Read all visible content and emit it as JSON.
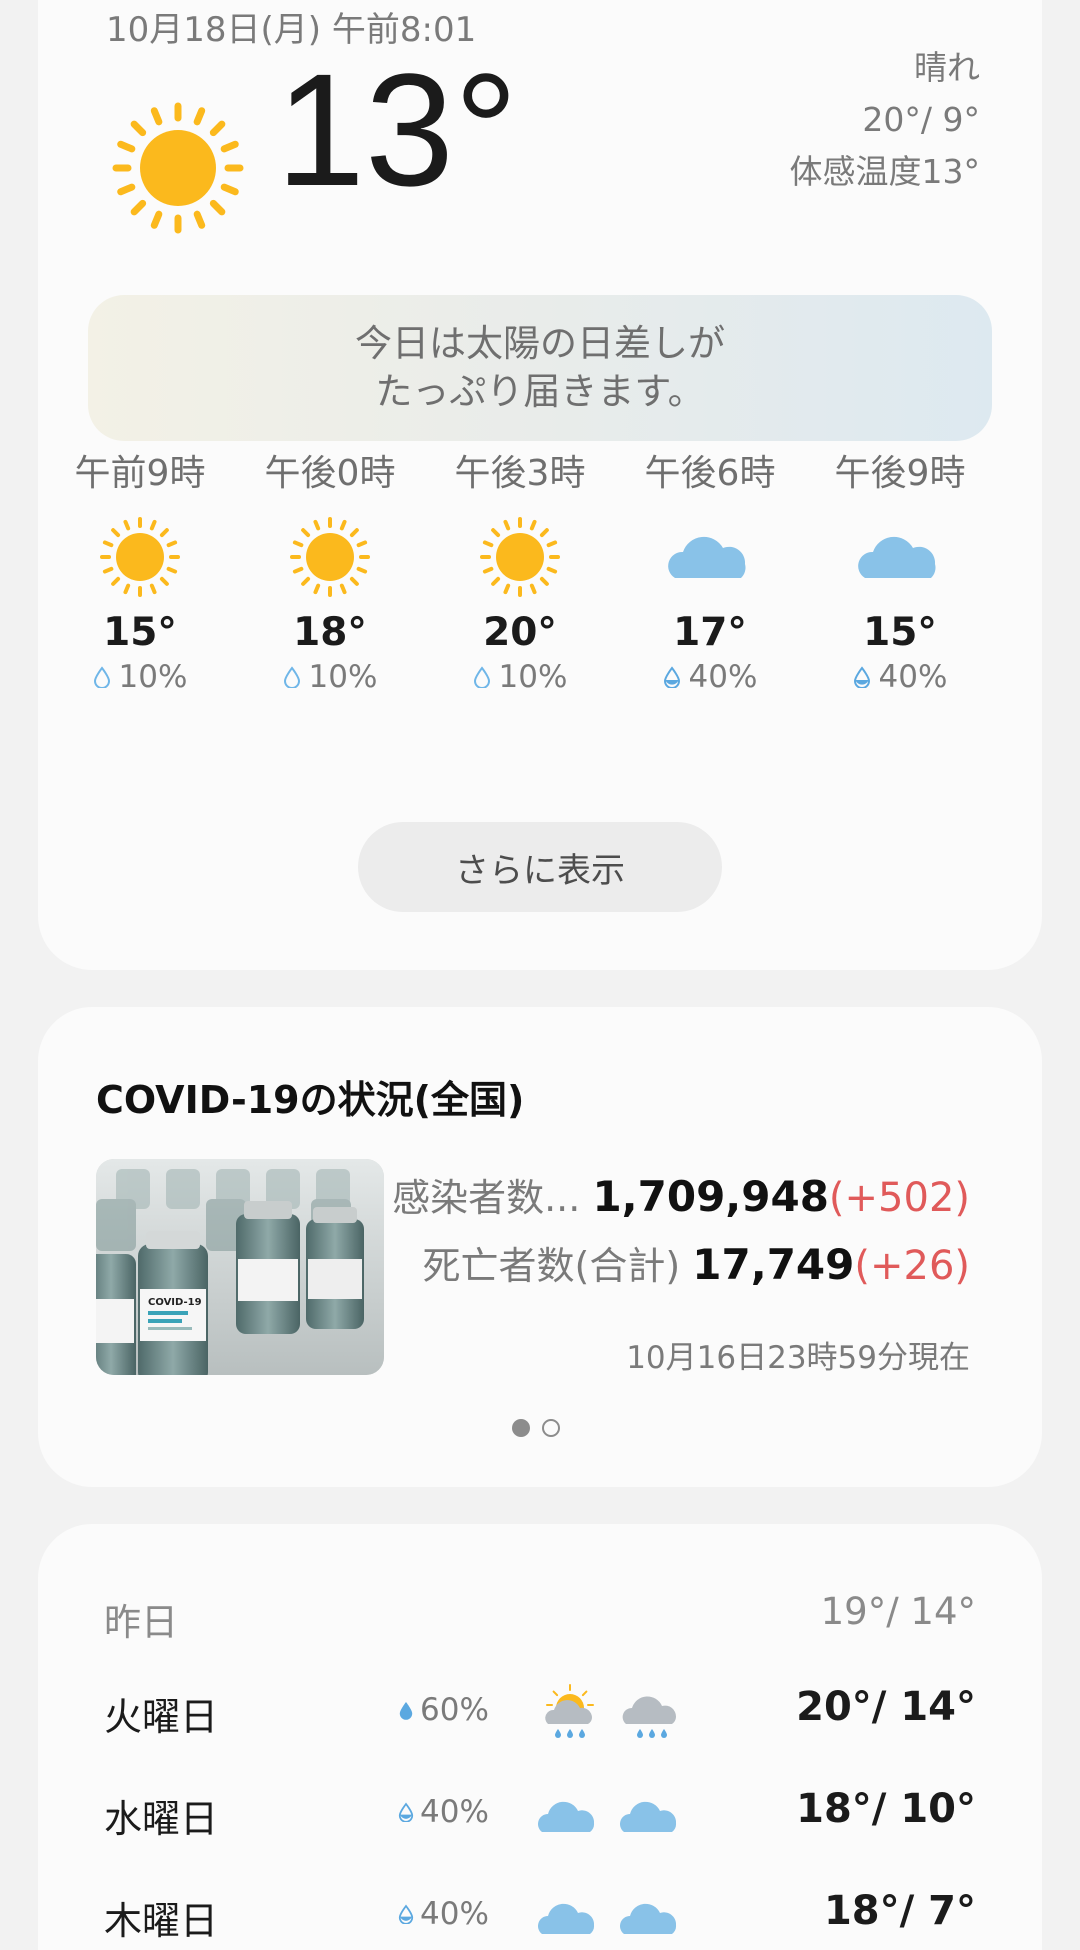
{
  "weather": {
    "datetime": "10月18日(月) 午前8:01",
    "temperature": "13°",
    "condition": "晴れ",
    "high_low": "20°/ 9°",
    "feels_like": "体感温度13°",
    "summary_line1": "今日は太陽の日差しが",
    "summary_line2": "たっぷり届きます。",
    "hourly": [
      {
        "time": "午前9時",
        "icon": "sun-icon",
        "temp": "15°",
        "precip": "10%"
      },
      {
        "time": "午後0時",
        "icon": "sun-icon",
        "temp": "18°",
        "precip": "10%"
      },
      {
        "time": "午後3時",
        "icon": "sun-icon",
        "temp": "20°",
        "precip": "10%"
      },
      {
        "time": "午後6時",
        "icon": "cloud-icon",
        "temp": "17°",
        "precip": "40%"
      },
      {
        "time": "午後9時",
        "icon": "cloud-icon",
        "temp": "15°",
        "precip": "40%"
      }
    ],
    "more_label": "さらに表示"
  },
  "covid": {
    "title": "COVID-19の状況(全国)",
    "infected_label": "感染者数...",
    "infected_value": "1,709,948",
    "infected_delta": "(+502)",
    "deaths_label": "死亡者数(合計)",
    "deaths_value": "17,749",
    "deaths_delta": "(+26)",
    "as_of": "10月16日23時59分現在",
    "vial_label": "COVID-19"
  },
  "daily": {
    "yesterday": {
      "day": "昨日",
      "high_low": "19°/ 14°"
    },
    "days": [
      {
        "day": "火曜日",
        "precip": "60%",
        "icon_am": "sun-cloud-rain-icon",
        "icon_pm": "cloud-rain-icon",
        "high_low": "20°/ 14°"
      },
      {
        "day": "水曜日",
        "precip": "40%",
        "icon_am": "cloud-icon",
        "icon_pm": "cloud-icon",
        "high_low": "18°/ 10°"
      },
      {
        "day": "木曜日",
        "precip": "40%",
        "icon_am": "cloud-icon",
        "icon_pm": "cloud-icon",
        "high_low": "18°/ 7°"
      }
    ]
  },
  "colors": {
    "sun": "#fbb91d",
    "cloud": "#89c2e8",
    "rain_cloud": "#b6bcc2",
    "delta_red": "#e05a5a",
    "card_bg": "#fbfbfb",
    "page_bg": "#f2f2f2"
  }
}
